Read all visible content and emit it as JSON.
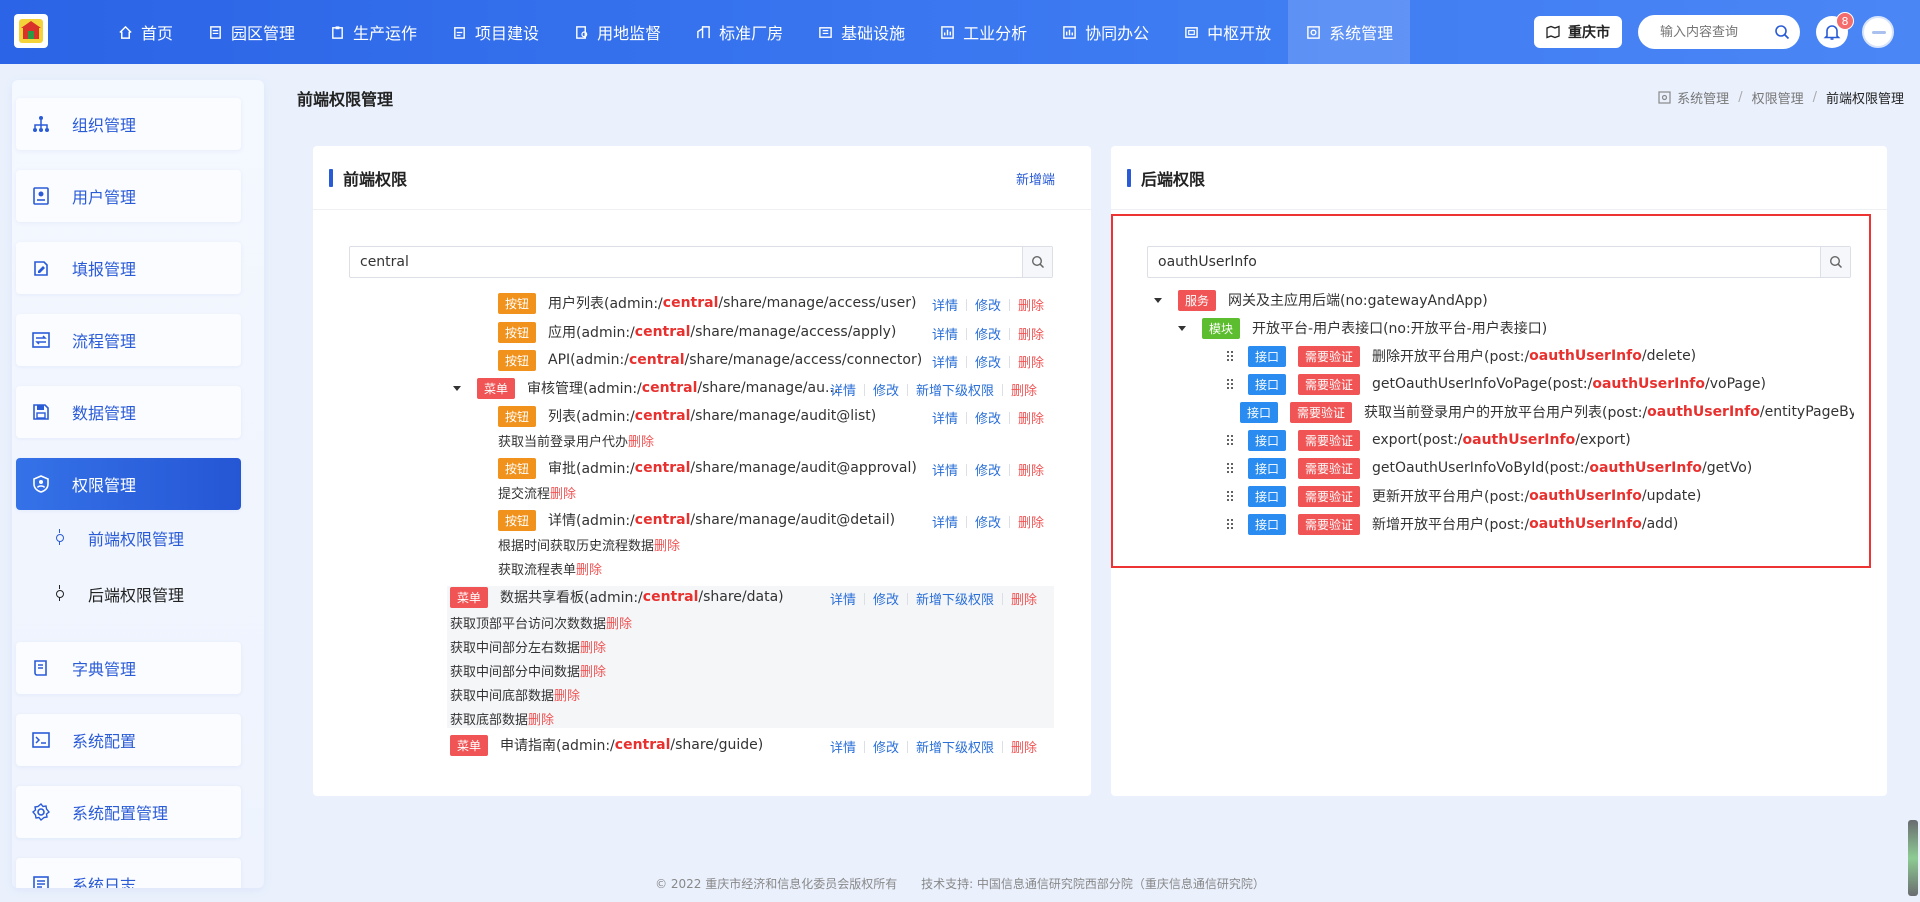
{
  "nav": [
    {
      "label": "首页",
      "icon": "home-icon",
      "active": false
    },
    {
      "label": "园区管理",
      "icon": "doc-icon",
      "active": false
    },
    {
      "label": "生产运作",
      "icon": "clipboard-icon",
      "active": false
    },
    {
      "label": "项目建设",
      "icon": "clipboard-icon",
      "active": false
    },
    {
      "label": "用地监督",
      "icon": "file-search-icon",
      "active": false
    },
    {
      "label": "标准厂房",
      "icon": "building-icon",
      "active": false
    },
    {
      "label": "基础设施",
      "icon": "grid-icon",
      "active": false
    },
    {
      "label": "工业分析",
      "icon": "chart-icon",
      "active": false
    },
    {
      "label": "协同办公",
      "icon": "chart-icon",
      "active": false
    },
    {
      "label": "中枢开放",
      "icon": "window-icon",
      "active": false
    },
    {
      "label": "系统管理",
      "icon": "gear-box-icon",
      "active": true
    }
  ],
  "topbar": {
    "city": "重庆市",
    "search_placeholder": "输入内容查询",
    "notif_count": "8"
  },
  "sidebar": {
    "items": [
      {
        "label": "组织管理",
        "icon": "org-icon"
      },
      {
        "label": "用户管理",
        "icon": "user-card-icon"
      },
      {
        "label": "填报管理",
        "icon": "edit-doc-icon"
      },
      {
        "label": "流程管理",
        "icon": "flow-icon"
      },
      {
        "label": "数据管理",
        "icon": "save-icon"
      },
      {
        "label": "权限管理",
        "icon": "shield-user-icon"
      },
      {
        "label": "字典管理",
        "icon": "book-icon"
      },
      {
        "label": "系统配置",
        "icon": "terminal-icon"
      },
      {
        "label": "系统配置管理",
        "icon": "gear-icon"
      },
      {
        "label": "系统日志",
        "icon": "log-icon"
      }
    ],
    "sub_items": [
      {
        "label": "前端权限管理",
        "active": true
      },
      {
        "label": "后端权限管理",
        "active": false
      }
    ]
  },
  "page": {
    "title": "前端权限管理",
    "breadcrumb": [
      "系统管理",
      "权限管理",
      "前端权限管理"
    ]
  },
  "front": {
    "title": "前端权限",
    "add_label": "新增端",
    "search_value": "central",
    "op_labels": {
      "detail": "详情",
      "edit": "修改",
      "add_child": "新增下级权限",
      "delete": "删除"
    },
    "rows": [
      {
        "tag": "按钮",
        "pre": "用户列表(admin:/",
        "hl": "central",
        "post": "/share/manage/access/user)"
      },
      {
        "tag": "按钮",
        "pre": "应用(admin:/",
        "hl": "central",
        "post": "/share/manage/access/apply)"
      },
      {
        "tag": "按钮",
        "pre": "API(admin:/",
        "hl": "central",
        "post": "/share/manage/access/connector)"
      },
      {
        "tag": "菜单",
        "pre": "审核管理(admin:/",
        "hl": "central",
        "post": "/share/manage/au..."
      },
      {
        "tag": "按钮",
        "pre": "列表(admin:/",
        "hl": "central",
        "post": "/share/manage/audit@list)"
      },
      {
        "tag": "按钮",
        "pre": "审批(admin:/",
        "hl": "central",
        "post": "/share/manage/audit@approval)"
      },
      {
        "tag": "按钮",
        "pre": "详情(admin:/",
        "hl": "central",
        "post": "/share/manage/audit@detail)"
      },
      {
        "tag": "菜单",
        "pre": "数据共享看板(admin:/",
        "hl": "central",
        "post": "/share/data)"
      },
      {
        "tag": "菜单",
        "pre": "申请指南(admin:/",
        "hl": "central",
        "post": "/share/guide)"
      }
    ],
    "sub_lines": [
      "获取当前登录用户代办",
      "提交流程",
      "根据时间获取历史流程数据",
      "获取流程表单",
      "获取顶部平台访问次数数据",
      "获取中间部分左右数据",
      "获取中间部分中间数据",
      "获取中间底部数据",
      "获取底部数据"
    ]
  },
  "back": {
    "title": "后端权限",
    "search_value": "oauthUserInfo",
    "service": {
      "tag": "服务",
      "label": "网关及主应用后端(no:gatewayAndApp)"
    },
    "module": {
      "tag": "模块",
      "label": "开放平台-用户表接口(no:开放平台-用户表接口)"
    },
    "api_tag": "接口",
    "auth_tag": "需要验证",
    "apis": [
      {
        "pre": "删除开放平台用户(post:/",
        "hl": "oauthUserInfo",
        "post": "/delete)"
      },
      {
        "pre": "getOauthUserInfoVoPage(post:/",
        "hl": "oauthUserInfo",
        "post": "/voPage)"
      },
      {
        "pre": "获取当前登录用户的开放平台用户列表(post:/",
        "hl": "oauthUserInfo",
        "post": "/entityPageByUs"
      },
      {
        "pre": "export(post:/",
        "hl": "oauthUserInfo",
        "post": "/export)"
      },
      {
        "pre": "getOauthUserInfoVoById(post:/",
        "hl": "oauthUserInfo",
        "post": "/getVo)"
      },
      {
        "pre": "更新开放平台用户(post:/",
        "hl": "oauthUserInfo",
        "post": "/update)"
      },
      {
        "pre": "新增开放平台用户(post:/",
        "hl": "oauthUserInfo",
        "post": "/add)"
      }
    ]
  },
  "footer": {
    "copyright": "© 2022 重庆市经济和信息化委员会版权所有",
    "support": "技术支持: 中国信息通信研究院西部分院（重庆信息通信研究院）"
  },
  "colors": {
    "primary": "#2a5bd7",
    "danger": "#f05454",
    "warning": "#f0921c",
    "success": "#5cbe2e",
    "info": "#2a8cf0"
  }
}
